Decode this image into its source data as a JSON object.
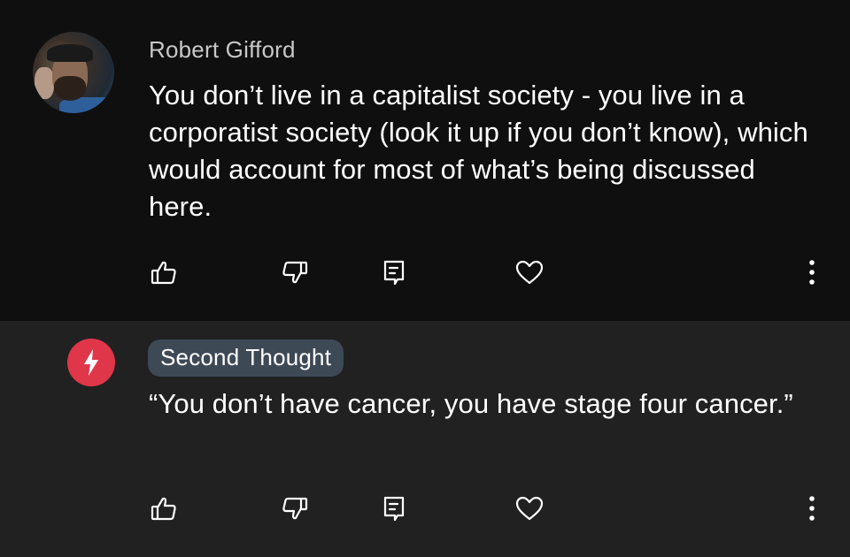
{
  "comments": [
    {
      "author": "Robert Gifford",
      "text": "You don’t live in a capitalist society - you live in a corporatist society (look it up if you don’t know), which would account for most of what’s being discussed here."
    },
    {
      "author": "Second Thought",
      "text": "“You don’t have cancer, you have stage four cancer.”"
    }
  ],
  "icons": {
    "like": "thumbs-up-icon",
    "dislike": "thumbs-down-icon",
    "reply": "reply-icon",
    "heart": "heart-icon",
    "more": "more-vertical-icon"
  },
  "colors": {
    "background_primary": "#0f0f0f",
    "background_highlight": "#212121",
    "author_badge": "#3e4956",
    "brand_avatar": "#e0364a"
  }
}
